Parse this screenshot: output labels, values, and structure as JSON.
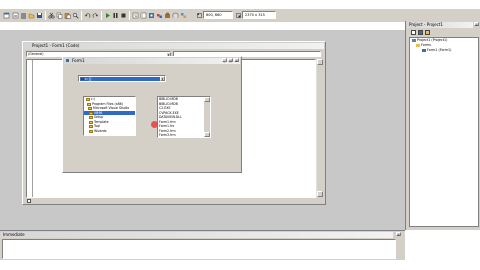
{
  "toolbar": {
    "position_readout": "600, 660",
    "size_readout": "2370 x 315"
  },
  "code_window": {
    "title": "Project1 - Form1 (Code)",
    "object_combo": "(General)",
    "proc_combo": ""
  },
  "form": {
    "title": "Form1",
    "drive_value": "c: []",
    "dir_items": [
      "c:\\",
      "Program Files (x86)",
      "Microsoft Visual Studio",
      "VB98",
      "Setup",
      "Template",
      "Tsql",
      "Wizards"
    ],
    "dir_selected_index": 3,
    "file_items": [
      "BIBLIO.MDB",
      "BIBLIO.MDB",
      "C2.EXE",
      "CVPACK.EXE",
      "DATAVIEW.DLL",
      "Form1.frm",
      "Form1.frx",
      "Form2.frm",
      "Form3.frm",
      "INSTALL.HTM"
    ]
  },
  "project_explorer": {
    "title": "Project - Project1",
    "project_node": "Project1 (Project1)",
    "folder_node": "Forms",
    "form_node": "Form1 (Form1)"
  },
  "immediate": {
    "title": "Immediate"
  }
}
